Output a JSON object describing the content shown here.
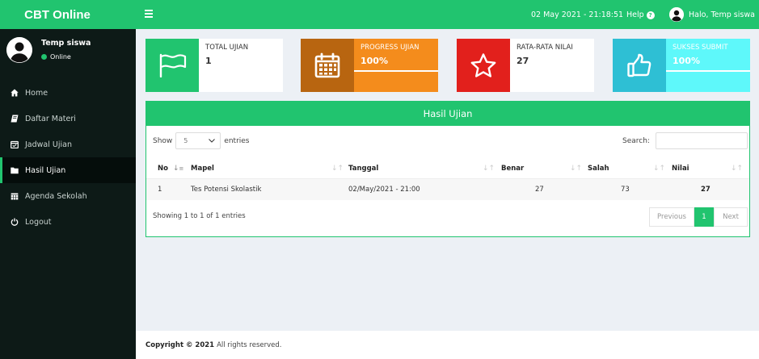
{
  "app": {
    "brand": "CBT Online"
  },
  "topbar": {
    "datetime": "02 May 2021 - 21:18:51",
    "help_label": "Help",
    "help_icon": "?",
    "greeting": "Halo, Temp siswa"
  },
  "user": {
    "name": "Temp siswa",
    "status": "Online"
  },
  "sidebar": {
    "items": [
      {
        "label": "Home",
        "icon": "home-icon"
      },
      {
        "label": "Daftar Materi",
        "icon": "book-icon"
      },
      {
        "label": "Jadwal Ujian",
        "icon": "calendar-check-icon"
      },
      {
        "label": "Hasil Ujian",
        "icon": "folder-icon",
        "active": true
      },
      {
        "label": "Agenda Sekolah",
        "icon": "calendar-icon"
      },
      {
        "label": "Logout",
        "icon": "power-icon"
      }
    ]
  },
  "stats": [
    {
      "label": "TOTAL UJIAN",
      "value": "1",
      "icon": "flag-icon",
      "color": "#21c46f"
    },
    {
      "label": "PROGRESS UJIAN",
      "value": "100%",
      "icon": "calendar-icon",
      "color": "#f48c1c",
      "progress": 100
    },
    {
      "label": "RATA-RATA NILAI",
      "value": "27",
      "icon": "star-icon",
      "color": "#e2201c"
    },
    {
      "label": "SUKSES SUBMIT",
      "value": "100%",
      "icon": "thumbs-up-icon",
      "color": "#5ef8fa",
      "progress": 100
    }
  ],
  "panel": {
    "title": "Hasil Ujian",
    "show_label": "Show",
    "entries_label": "entries",
    "page_size": "5",
    "search_label": "Search:",
    "search_value": "",
    "columns": [
      "No",
      "Mapel",
      "Tanggal",
      "Benar",
      "Salah",
      "Nilai"
    ],
    "rows": [
      {
        "no": "1",
        "mapel": "Tes Potensi Skolastik",
        "tanggal": "02/May/2021 - 21:00",
        "benar": "27",
        "salah": "73",
        "nilai": "27"
      }
    ],
    "info": "Showing 1 to 1 of 1 entries",
    "pagination": {
      "previous": "Previous",
      "current": "1",
      "next": "Next"
    }
  },
  "footer": {
    "copyright": "Copyright © 2021",
    "rights": "All rights reserved."
  },
  "colors": {
    "accent": "#21c46f",
    "sidebar": "#0d1a17",
    "background": "#ecf0f5"
  }
}
